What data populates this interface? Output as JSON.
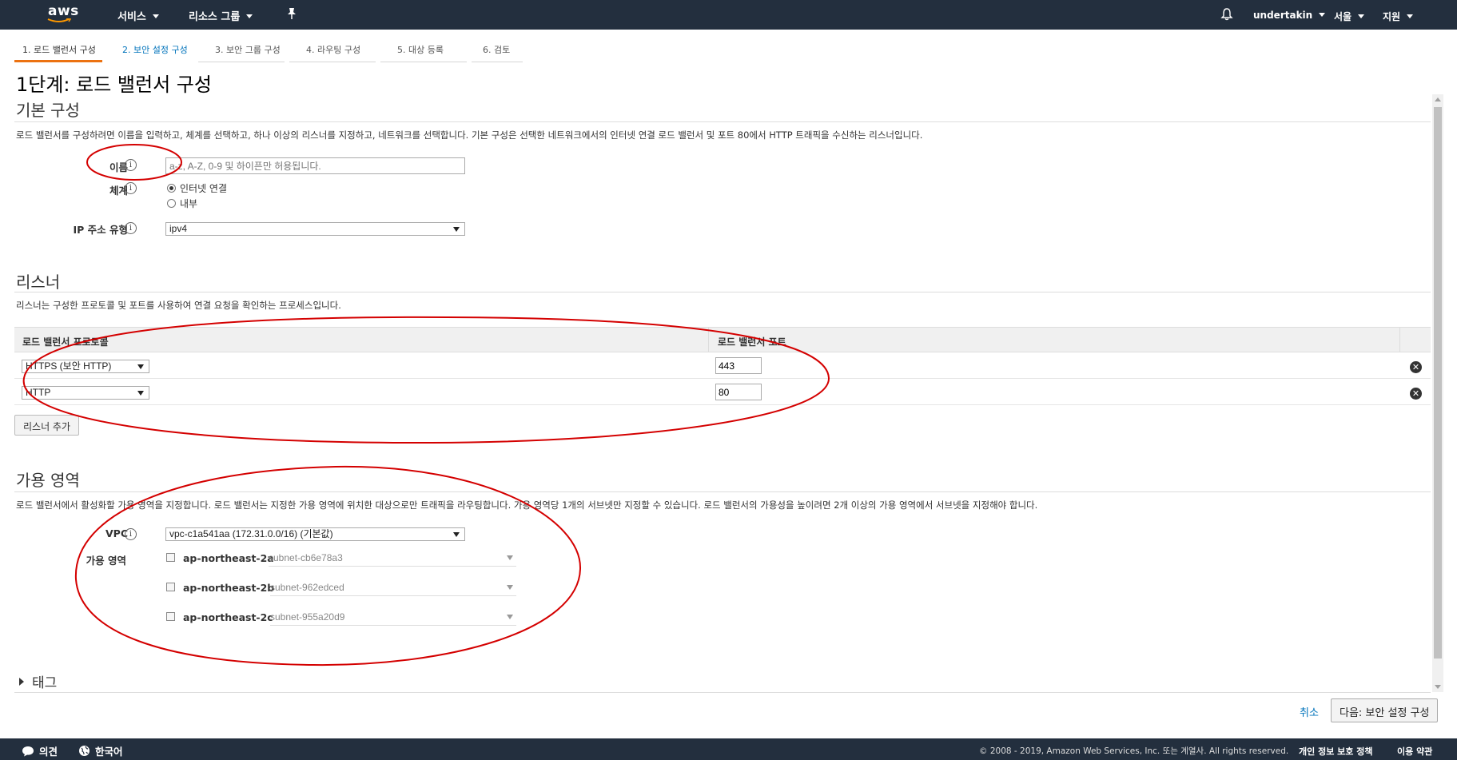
{
  "nav": {
    "logo": "aws",
    "services": "서비스",
    "resource_groups": "리소스 그룹",
    "user": "undertakin",
    "region": "서울",
    "support": "지원"
  },
  "steps": [
    "1. 로드 밸런서 구성",
    "2. 보안 설정 구성",
    "3. 보안 그룹 구성",
    "4. 라우팅 구성",
    "5. 대상 등록",
    "6. 검토"
  ],
  "page_title": "1단계: 로드 밸런서 구성",
  "basic": {
    "title": "기본 구성",
    "desc": "로드 밸런서를 구성하려면 이름을 입력하고, 체계를 선택하고, 하나 이상의 리스너를 지정하고, 네트워크를 선택합니다. 기본 구성은 선택한 네트워크에서의 인터넷 연결 로드 밸런서 및 포트 80에서 HTTP 트래픽을 수신하는 리스너입니다.",
    "name_label": "이름",
    "name_placeholder": "a-z, A-Z, 0-9 및 하이픈만 허용됩니다.",
    "scheme_label": "체계",
    "scheme_internet": "인터넷 연결",
    "scheme_internal": "내부",
    "ip_label": "IP 주소 유형",
    "ip_value": "ipv4"
  },
  "listeners": {
    "title": "리스너",
    "desc": "리스너는 구성한 프로토콜 및 포트를 사용하여 연결 요청을 확인하는 프로세스입니다.",
    "col_protocol": "로드 밸런서 프로토콜",
    "col_port": "로드 밸런서 포트",
    "rows": [
      {
        "protocol": "HTTPS (보안 HTTP)",
        "port": "443"
      },
      {
        "protocol": "HTTP",
        "port": "80"
      }
    ],
    "add_button": "리스너 추가"
  },
  "az": {
    "title": "가용 영역",
    "desc": "로드 밸런서에서 활성화할 가용 영역을 지정합니다. 로드 밸런서는 지정한 가용 영역에 위치한 대상으로만 트래픽을 라우팅합니다. 가용 영역당 1개의 서브넷만 지정할 수 있습니다. 로드 밸런서의 가용성을 높이려면 2개 이상의 가용 영역에서 서브넷을 지정해야 합니다.",
    "vpc_label": "VPC",
    "vpc_value": "vpc-c1a541aa (172.31.0.0/16) (기본값)",
    "zones_label": "가용 영역",
    "zones": [
      {
        "name": "ap-northeast-2a",
        "subnet": "subnet-cb6e78a3"
      },
      {
        "name": "ap-northeast-2b",
        "subnet": "subnet-962edced"
      },
      {
        "name": "ap-northeast-2c",
        "subnet": "subnet-955a20d9"
      }
    ]
  },
  "tags_label": "태그",
  "actions": {
    "cancel": "취소",
    "next": "다음: 보안 설정 구성"
  },
  "footer": {
    "feedback": "의견",
    "language": "한국어",
    "copyright": "© 2008 - 2019, Amazon Web Services, Inc. 또는 계열사. All rights reserved.",
    "privacy": "개인 정보 보호 정책",
    "terms": "이용 약관"
  },
  "colors": {
    "nav_bg": "#232f3e",
    "active_step": "#ec7211",
    "link": "#0073bb",
    "annotation": "#d40000"
  },
  "icons": [
    "bell-icon",
    "pin-icon",
    "info-icon",
    "remove-icon",
    "chat-icon",
    "globe-icon"
  ]
}
